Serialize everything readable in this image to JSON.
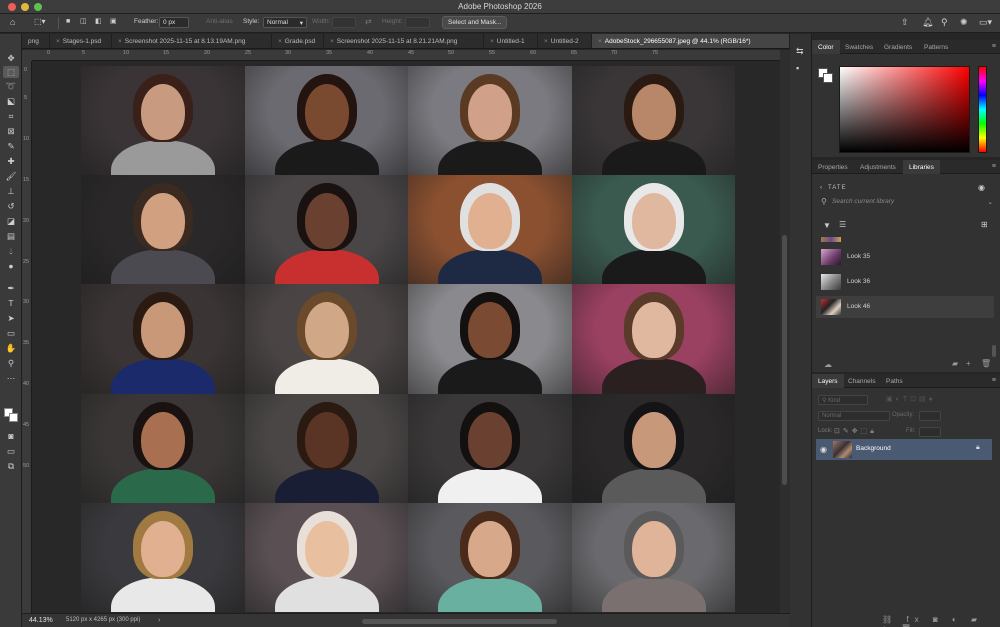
{
  "app": {
    "title": "Adobe Photoshop 2026"
  },
  "options_bar": {
    "feather_label": "Feather:",
    "feather_value": "0 px",
    "anti_alias_label": "Anti-alias",
    "style_label": "Style:",
    "style_value": "Normal",
    "width_label": "Width:",
    "height_label": "Height:",
    "select_mask_label": "Select and Mask..."
  },
  "tabs": [
    {
      "label": "png",
      "close": "×"
    },
    {
      "label": "Stages-1.psd",
      "close": "×"
    },
    {
      "label": "Screenshot 2025-11-15 at 8.13.19AM.png",
      "close": "×"
    },
    {
      "label": "Grade.psd",
      "close": "×"
    },
    {
      "label": "Screenshot 2025-11-15 at 8.21.21AM.png",
      "close": "×"
    },
    {
      "label": "Untitled-1",
      "close": "×"
    },
    {
      "label": "Untitled-2",
      "close": "×"
    },
    {
      "label": "AdobeStock_296655087.jpeg @ 44.1% (RGB/16*)",
      "close": "×"
    }
  ],
  "ruler": {
    "h": [
      "0",
      "5",
      "10",
      "15",
      "20",
      "25",
      "30",
      "35",
      "40",
      "45",
      "50",
      "55",
      "60",
      "65",
      "70",
      "75"
    ],
    "v": [
      "0",
      "5",
      "10",
      "15",
      "20",
      "25",
      "30",
      "35",
      "40",
      "45",
      "50"
    ]
  },
  "status": {
    "zoom": "44.13%",
    "doc_info": "5120 px x 4265 px (300 ppi)"
  },
  "color_panel": {
    "tabs": [
      "Color",
      "Swatches",
      "Gradients",
      "Patterns"
    ],
    "hue_color": "#ff0000"
  },
  "libraries_panel": {
    "tabs": [
      "Properties",
      "Adjustments",
      "Libraries"
    ],
    "library_name": "TATE",
    "search_placeholder": "Search current library",
    "items": [
      {
        "label": "Look 35"
      },
      {
        "label": "Look 36"
      },
      {
        "label": "Look 46"
      }
    ]
  },
  "layers_panel": {
    "tabs": [
      "Layers",
      "Channels",
      "Paths"
    ],
    "kind_label": "Kind",
    "blend_mode": "Normal",
    "opacity_label": "Opacity:",
    "lock_label": "Lock:",
    "fill_label": "Fill:",
    "layers": [
      {
        "name": "Background"
      }
    ]
  }
}
